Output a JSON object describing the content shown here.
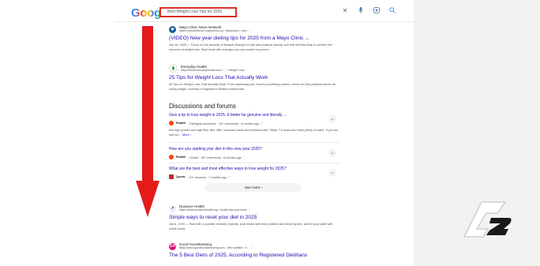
{
  "header": {
    "logo": "Google",
    "query": "Best Weight Loss Tips for 2025",
    "icons": [
      "clear-icon",
      "mic-icon",
      "lens-icon",
      "search-icon"
    ]
  },
  "results": [
    {
      "source_name": "Mayo Clinic News Network",
      "source_url": "https://newsnetwork.mayoclinic.org › discussion › new-...  ⋮",
      "title": "(VIDEO) New year dieting tips for 2025 from a Mayo Clinic ...",
      "snippet": "Jan 16, 2025 — Focus on the process of lifestyle changes to diet and physical activity, and that will best help to achieve the outcome of weight loss. Start small with changes you can sustain long-term...."
    },
    {
      "source_name": "Everyday Health",
      "source_url": "https://www.everydayhealth.com › ... › Weight Loss  ⋮",
      "title": "25 Tips for Weight Loss That Actually Work",
      "snippet": "25 Tips for Weight Loss That Actually Work. From assessing your food to prioritizing protein, check out this practical advice for losing weight, courtesy of registered dietitian-nutritionists."
    }
  ],
  "discussions": {
    "heading": "Discussions and forums",
    "items": [
      {
        "title": "Give a tip to lose weight in 2025. It better be genuine and literally ...",
        "site": "Reddit",
        "meta": "· r/WeightLossAdvice · 10+ comments · 8 months ago  ⋮",
        "snippet": "Eat high protein and high fiber diet. With minimum carbs and minimum fats. Sleep 7-8 hours and drink plenty of water. If you are still not ...",
        "more": "More ›"
      },
      {
        "title": "How are you starting your diet in this new year 2025?",
        "site": "Reddit",
        "meta": "· r/loseit · 30+ comments · 8 months ago  ⋮",
        "snippet": "",
        "more": ""
      },
      {
        "title": "What are the best and most effective ways to lose weight for 2025?",
        "site": "Quora",
        "meta": "· 10+ answers · 2 months ago  ⋮",
        "snippet": "",
        "more": ""
      }
    ],
    "see_more": "See more  ›"
  },
  "results2": [
    {
      "source_name": "Nuvance Health",
      "source_url": "https://www.nuvancehealth.org › health-tips-and-news  ⋮",
      "title": "Simple ways to reset your diet in 2025",
      "snippet": "Jan 6, 2025 — Start with a positive mindset, hydrate, plan meals with lean proteins and whole grains, and fill your plate with whole foods."
    },
    {
      "source_name": "Good Housekeeping",
      "source_url": "https://www.goodhousekeeping.com › diet-nutrition › b...  ⋮",
      "title": "The 5 Best Diets of 2025, According to Registered Dietitians",
      "snippet": ""
    }
  ],
  "colors": {
    "link": "#1a0dab",
    "highlight": "#d93025",
    "arrow": "#e31b1b"
  }
}
